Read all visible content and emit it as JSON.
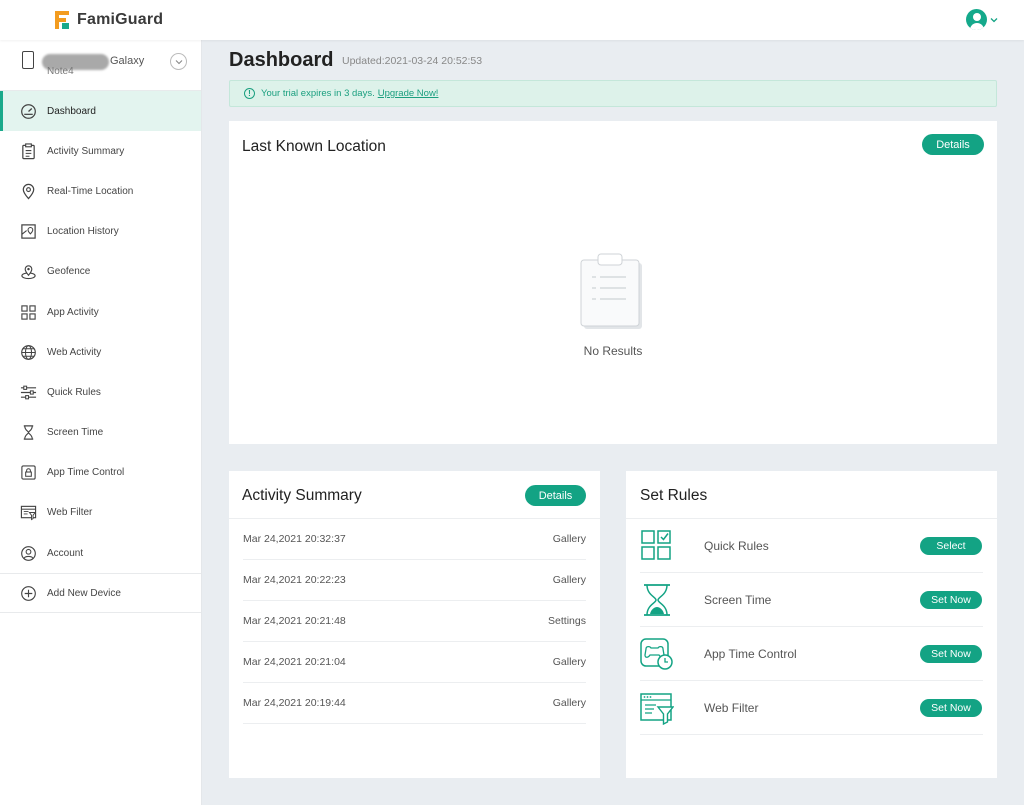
{
  "app": {
    "brand": "FamiGuard",
    "accent": "#13a384"
  },
  "device": {
    "name_suffix": "Galaxy",
    "name_line2": "Note4"
  },
  "sidebar": {
    "items": [
      {
        "label": "Dashboard",
        "icon": "dashboard-gauge-icon",
        "active": true
      },
      {
        "label": "Activity Summary",
        "icon": "clipboard-icon"
      },
      {
        "label": "Real-Time Location",
        "icon": "location-pin-icon"
      },
      {
        "label": "Location History",
        "icon": "map-history-icon"
      },
      {
        "label": "Geofence",
        "icon": "geofence-icon"
      },
      {
        "label": "App Activity",
        "icon": "app-grid-icon"
      },
      {
        "label": "Web Activity",
        "icon": "globe-icon"
      },
      {
        "label": "Quick Rules",
        "icon": "sliders-icon"
      },
      {
        "label": "Screen Time",
        "icon": "hourglass-icon"
      },
      {
        "label": "App Time Control",
        "icon": "app-lock-icon"
      },
      {
        "label": "Web Filter",
        "icon": "web-filter-icon"
      },
      {
        "label": "Account",
        "icon": "account-icon"
      }
    ],
    "add_device": "Add New Device"
  },
  "header": {
    "title": "Dashboard",
    "updated": "Updated:2021-03-24 20:52:53"
  },
  "trial": {
    "text": "Your trial expires in 3 days.",
    "link": "Upgrade Now!"
  },
  "location": {
    "title": "Last Known Location",
    "details_label": "Details",
    "empty_text": "No Results"
  },
  "activity": {
    "title": "Activity Summary",
    "details_label": "Details",
    "rows": [
      {
        "time": "Mar 24,2021 20:32:37",
        "app": "Gallery"
      },
      {
        "time": "Mar 24,2021 20:22:23",
        "app": "Gallery"
      },
      {
        "time": "Mar 24,2021 20:21:48",
        "app": "Settings"
      },
      {
        "time": "Mar 24,2021 20:21:04",
        "app": "Gallery"
      },
      {
        "time": "Mar 24,2021 20:19:44",
        "app": "Gallery"
      }
    ]
  },
  "rules": {
    "title": "Set Rules",
    "items": [
      {
        "label": "Quick Rules",
        "button": "Select",
        "icon": "quick-rules-icon"
      },
      {
        "label": "Screen Time",
        "button": "Set Now",
        "icon": "hourglass-icon"
      },
      {
        "label": "App Time Control",
        "button": "Set Now",
        "icon": "app-time-control-icon"
      },
      {
        "label": "Web Filter",
        "button": "Set Now",
        "icon": "web-filter-icon"
      }
    ]
  }
}
